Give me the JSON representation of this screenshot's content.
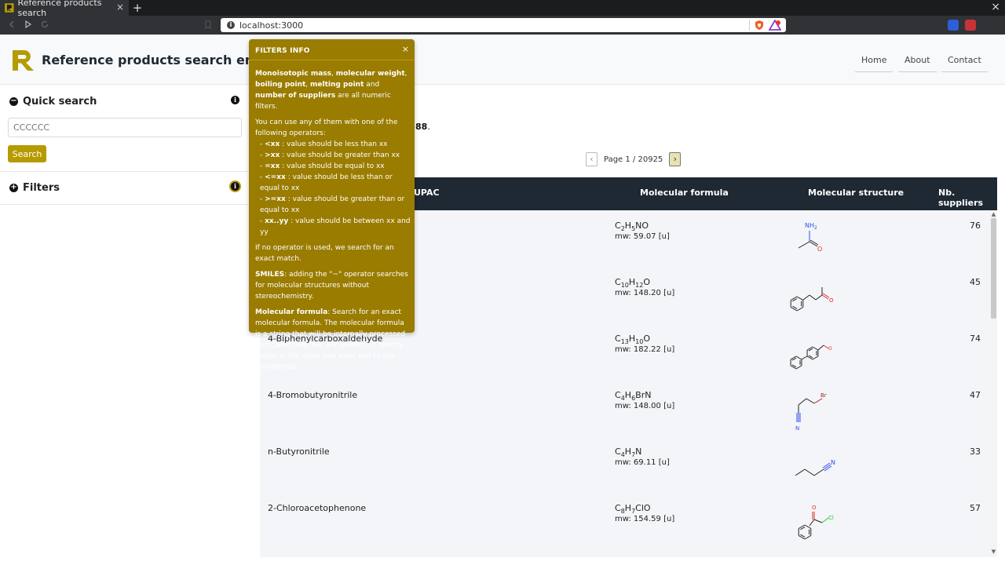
{
  "browser": {
    "tab_title": "Reference products search",
    "tab_close": "×",
    "new_tab": "+",
    "window_close": "×",
    "url": "localhost:3000"
  },
  "header": {
    "title": "Reference products search engine",
    "nav": [
      "Home",
      "About",
      "Contact"
    ]
  },
  "sidebar": {
    "quick_search_title": "Quick search",
    "search_placeholder": "CCCCCC",
    "search_button": "Search",
    "filters_title": "Filters"
  },
  "results": {
    "summary_tail": "88",
    "summary_dot": ".",
    "page_label": "Page 1 / 20925"
  },
  "table": {
    "columns": [
      "UPAC",
      "Molecular formula",
      "Molecular structure",
      "Nb. suppliers"
    ],
    "rows": [
      {
        "name": "",
        "formula_parts": [
          [
            "C",
            ""
          ],
          [
            "2",
            "sub"
          ],
          [
            "H",
            ""
          ],
          [
            "5",
            "sub"
          ],
          [
            "NO",
            ""
          ]
        ],
        "mw": "mw: 59.07 [u]",
        "suppliers": "76",
        "structure": "acetamide"
      },
      {
        "name": "",
        "formula_parts": [
          [
            "C",
            ""
          ],
          [
            "10",
            "sub"
          ],
          [
            "H",
            ""
          ],
          [
            "12",
            "sub"
          ],
          [
            "O",
            ""
          ]
        ],
        "mw": "mw: 148.20 [u]",
        "suppliers": "45",
        "structure": "benzylacetone"
      },
      {
        "name": "4-Biphenylcarboxaldehyde",
        "formula_parts": [
          [
            "C",
            ""
          ],
          [
            "13",
            "sub"
          ],
          [
            "H",
            ""
          ],
          [
            "10",
            "sub"
          ],
          [
            "O",
            ""
          ]
        ],
        "mw": "mw: 182.22 [u]",
        "suppliers": "74",
        "structure": "biphenylcarboxaldehyde"
      },
      {
        "name": "4-Bromobutyronitrile",
        "formula_parts": [
          [
            "C",
            ""
          ],
          [
            "4",
            "sub"
          ],
          [
            "H",
            ""
          ],
          [
            "6",
            "sub"
          ],
          [
            "BrN",
            ""
          ]
        ],
        "mw": "mw: 148.00 [u]",
        "suppliers": "47",
        "structure": "bromobutyronitrile"
      },
      {
        "name": "n-Butyronitrile",
        "formula_parts": [
          [
            "C",
            ""
          ],
          [
            "4",
            "sub"
          ],
          [
            "H",
            ""
          ],
          [
            "7",
            "sub"
          ],
          [
            "N",
            ""
          ]
        ],
        "mw": "mw: 69.11 [u]",
        "suppliers": "33",
        "structure": "butyronitrile"
      },
      {
        "name": "2-Chloroacetophenone",
        "formula_parts": [
          [
            "C",
            ""
          ],
          [
            "8",
            "sub"
          ],
          [
            "H",
            ""
          ],
          [
            "7",
            "sub"
          ],
          [
            "ClO",
            ""
          ]
        ],
        "mw": "mw: 154.59 [u]",
        "suppliers": "57",
        "structure": "chloroacetophenone"
      }
    ],
    "atom_labels": {
      "nh2": "NH",
      "nh2_sub": "2",
      "o": "O",
      "br": "Br",
      "n": "N",
      "cl": "Cl"
    }
  },
  "filters_info": {
    "title": "FILTERS INFO",
    "close": "×",
    "p1_b1": "Monoisotopic mass",
    "p1_t1": ", ",
    "p1_b2": "molecular weight",
    "p1_t2": ", ",
    "p1_b3": "boiling point",
    "p1_t3": ", ",
    "p1_b4": "melting point",
    "p1_t4": " and ",
    "p1_b5": "number of suppliers",
    "p1_t5": " are all numeric filters.",
    "p2": "You can use any of them with one of the following operators:",
    "ops": [
      {
        "op": "<xx",
        "desc": " : value should be less than xx"
      },
      {
        "op": ">xx",
        "desc": " : value should be greater than xx"
      },
      {
        "op": "=xx",
        "desc": " : value should be equal to xx"
      },
      {
        "op": "<=xx",
        "desc": " : value should be less than or equal to xx"
      },
      {
        "op": ">=xx",
        "desc": " : value should be greater than or equal to xx"
      },
      {
        "op": "xx..yy",
        "desc": " : value should be between xx and yy"
      }
    ],
    "op_prefix": "- ",
    "p3": "If no operator is used, we search for an exact match.",
    "p4_b": "SMILES",
    "p4_t": ": adding the \"~\" operator searches for molecular structures without stereochemistry.",
    "p5_b": "Molecular formula",
    "p5_t": ": Search for an exact molecular formula. The molecular formula is a string that will be internally processed and canonized. You are allowed to specify atoms in the order you want and to use parenthesis."
  },
  "colors": {
    "accent": "#b59b00",
    "popup_bg": "#9a7c00",
    "table_header": "#1f2933",
    "oxygen": "#e0302a",
    "nitrogen": "#3050f8",
    "bromine": "#a62929",
    "chlorine": "#1fd01f"
  },
  "icons": {
    "collapse": "minus-circle-icon",
    "expand": "plus-circle-icon",
    "info": "info-icon"
  }
}
